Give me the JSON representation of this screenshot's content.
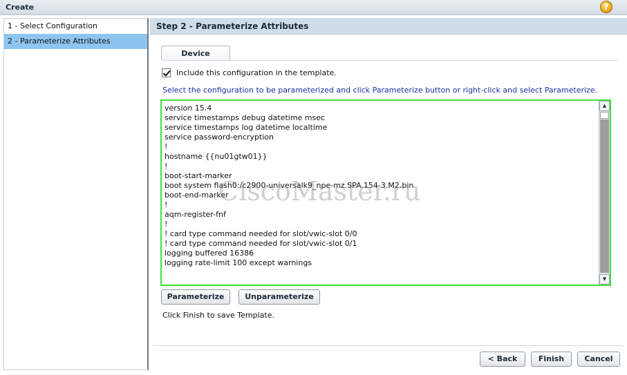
{
  "window": {
    "title": "Create"
  },
  "steps": [
    {
      "label": "1 - Select Configuration",
      "active": false
    },
    {
      "label": "2 - Parameterize Attributes",
      "active": true
    }
  ],
  "main": {
    "header": "Step 2 - Parameterize Attributes",
    "tab_label": "Device",
    "include_label": "Include this configuration in the template.",
    "include_checked": true,
    "instruction": "Select the configuration to be parameterized and click Parameterize button or right-click and select Parameterize.",
    "config_lines": [
      "version 15.4",
      "service timestamps debug datetime msec",
      "service timestamps log datetime localtime",
      "service password-encryption",
      "!",
      "hostname {{nu01gtw01}}",
      "!",
      "boot-start-marker",
      "boot system flash0:/c2900-universalk9_npe-mz.SPA.154-3.M2.bin",
      "boot-end-marker",
      "!",
      "aqm-register-fnf",
      "!",
      "! card type command needed for slot/vwic-slot 0/0",
      "! card type command needed for slot/vwic-slot 0/1",
      "logging buffered 16386",
      "logging rate-limit 100 except warnings"
    ],
    "parameterize_label": "Parameterize",
    "unparameterize_label": "Unparameterize",
    "finish_note": "Click Finish to save Template."
  },
  "footer": {
    "back_label": "< Back",
    "finish_label": "Finish",
    "cancel_label": "Cancel"
  },
  "watermark": "CiscoMaster.ru",
  "colors": {
    "active_step": "#8ec5f0",
    "header_bg": "#cfdde8",
    "config_border": "#3ee13a",
    "instruction_text": "#1a2fa0"
  }
}
